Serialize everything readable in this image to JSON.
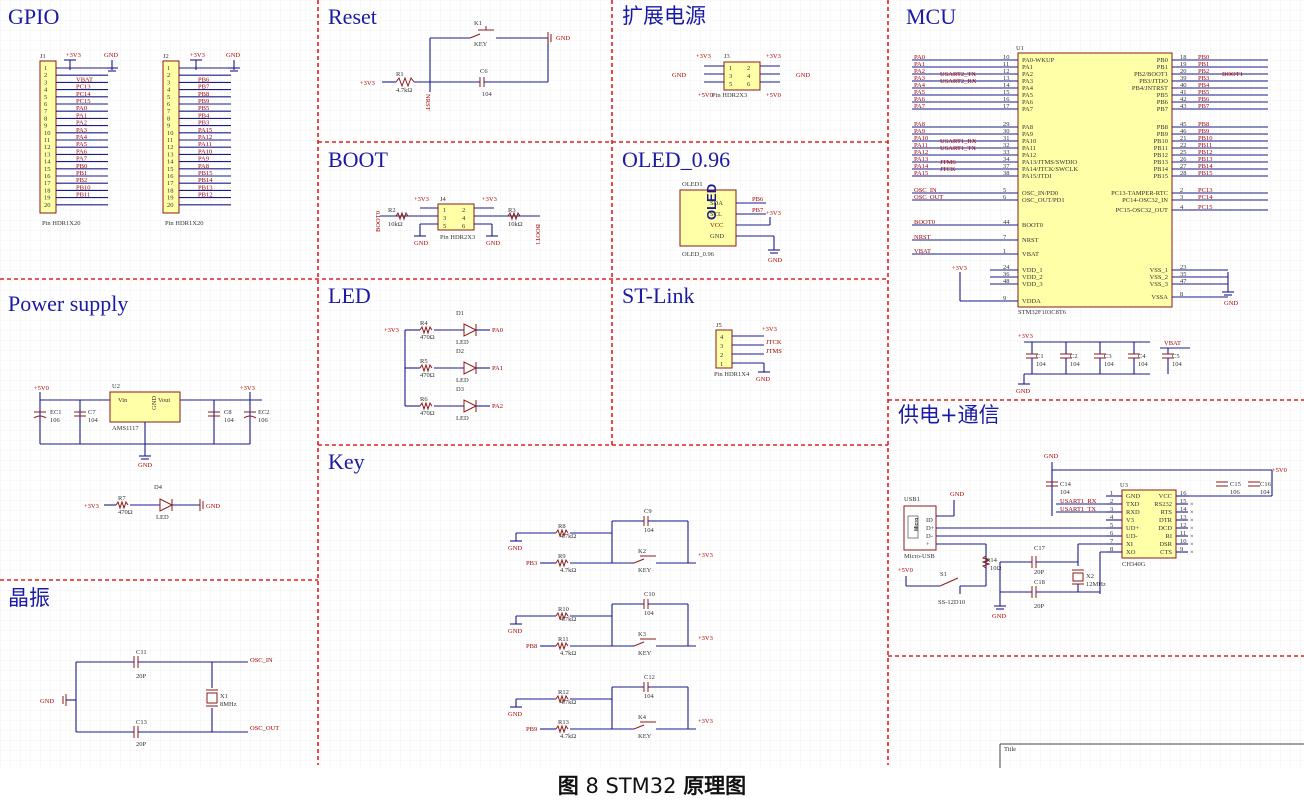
{
  "caption": {
    "prefix": "图",
    "number": " 8 STM32 ",
    "suffix": "原理图"
  },
  "sections": {
    "gpio": "GPIO",
    "reset": "Reset",
    "expand_power": "扩展电源",
    "mcu": "MCU",
    "boot": "BOOT",
    "oled": "OLED_0.96",
    "power_supply": "Power supply",
    "led": "LED",
    "stlink": "ST-Link",
    "key": "Key",
    "crystal": "晶振",
    "power_comm": "供电+通信"
  },
  "gpio": {
    "j1": {
      "ref": "J1",
      "footprint": "Pin HDR1X20",
      "pins": [
        "+3V3",
        "GND",
        "VBAT",
        "PC13",
        "PC14",
        "PC15",
        "PA0",
        "PA1",
        "PA2",
        "PA3",
        "PA4",
        "PA5",
        "PA6",
        "PA7",
        "PB0",
        "PB1",
        "PB2",
        "PB10",
        "PB11",
        ""
      ]
    },
    "j2": {
      "ref": "J2",
      "footprint": "Pin HDR1X20",
      "pins": [
        "+3V3",
        "GND",
        "PB6",
        "PB7",
        "PB8",
        "PB9",
        "PB5",
        "PB4",
        "PB3",
        "PA15",
        "PA12",
        "PA11",
        "PA10",
        "PA9",
        "PA8",
        "PB15",
        "PB14",
        "PB13",
        "PB12",
        ""
      ]
    }
  },
  "reset": {
    "sw": "K1",
    "sw_val": "KEY",
    "gnd": "GND",
    "r": "R1",
    "r_val": "4.7kΩ",
    "vcc": "+3V3",
    "c": "C6",
    "c_val": "104",
    "net": "NRST"
  },
  "expand": {
    "ref": "J3",
    "footprint": "Pin HDR2X3",
    "nets": [
      "+3V3",
      "+3V3",
      "GND",
      "GND",
      "+5V0",
      "+5V0"
    ]
  },
  "boot": {
    "ref": "J4",
    "footprint": "Pin HDR2X3",
    "r2": "R2",
    "r3": "R3",
    "r_val": "10kΩ",
    "vcc": "+3V3",
    "gnd": "GND",
    "net0": "BOOT0",
    "net1": "BOOT1"
  },
  "oled": {
    "ref": "OLED1",
    "name": "OLED",
    "val": "OLED_0.96",
    "pins": [
      "SDA",
      "SCL",
      "VCC",
      "GND"
    ],
    "nets": [
      "PB6",
      "PB7",
      "+3V3",
      "GND"
    ]
  },
  "power": {
    "in": "+5V0",
    "out": "+3V3",
    "u": "U2",
    "u_val": "AMS1117",
    "vin": "Vin",
    "vout": "Vout",
    "gnd": "GND",
    "ec1": "EC1",
    "ec1_val": "106",
    "c7": "C7",
    "c7_val": "104",
    "c8": "C8",
    "c8_val": "104",
    "ec2": "EC2",
    "ec2_val": "106",
    "r7": "R7",
    "r7_val": "470Ω",
    "d4": "D4",
    "d_val": "LED",
    "vcc": "+3V3"
  },
  "led": {
    "vcc": "+3V3",
    "rows": [
      {
        "r": "R4",
        "rv": "470Ω",
        "d": "D1",
        "dv": "LED",
        "net": "PA0"
      },
      {
        "r": "R5",
        "rv": "470Ω",
        "d": "D2",
        "dv": "LED",
        "net": "PA1"
      },
      {
        "r": "R6",
        "rv": "470Ω",
        "d": "D3",
        "dv": "LED",
        "net": "PA2"
      }
    ]
  },
  "stlink": {
    "ref": "J5",
    "footprint": "Pin HDR1X4",
    "nets": [
      "+3V3",
      "JTCK",
      "JTMS",
      "GND"
    ]
  },
  "keys": [
    {
      "r1": "R8",
      "c": "C9",
      "r2": "R9",
      "k": "K2",
      "net": "PB3",
      "rv": "4.7kΩ",
      "cv": "104",
      "kv": "KEY",
      "vcc": "+3V3",
      "gnd": "GND"
    },
    {
      "r1": "R10",
      "c": "C10",
      "r2": "R11",
      "k": "K3",
      "net": "PB8",
      "rv": "4.7kΩ",
      "cv": "104",
      "kv": "KEY",
      "vcc": "+3V3",
      "gnd": "GND"
    },
    {
      "r1": "R12",
      "c": "C12",
      "r2": "R13",
      "k": "K4",
      "net": "PB9",
      "rv": "4.7kΩ",
      "cv": "104",
      "kv": "KEY",
      "vcc": "+3V3",
      "gnd": "GND"
    }
  ],
  "crystal": {
    "c11": "C11",
    "c13": "C13",
    "c_val": "20P",
    "x": "X1",
    "x_val": "8MHz",
    "gnd": "GND",
    "net_in": "OSC_IN",
    "net_out": "OSC_OUT"
  },
  "mcu": {
    "ref": "U1",
    "part": "STM32F103C8T6",
    "left_pins": [
      {
        "pin": "10",
        "name": "PA0-WKUP",
        "net": "PA0"
      },
      {
        "pin": "11",
        "name": "PA1",
        "net": "PA1"
      },
      {
        "pin": "12",
        "name": "PA2",
        "net": "PA2",
        "net2": "USART2_TX"
      },
      {
        "pin": "13",
        "name": "PA3",
        "net": "PA3",
        "net2": "USART2_RX"
      },
      {
        "pin": "14",
        "name": "PA4",
        "net": "PA4"
      },
      {
        "pin": "15",
        "name": "PA5",
        "net": "PA5"
      },
      {
        "pin": "16",
        "name": "PA6",
        "net": "PA6"
      },
      {
        "pin": "17",
        "name": "PA7",
        "net": "PA7"
      },
      {
        "pin": "29",
        "name": "PA8",
        "net": "PA8"
      },
      {
        "pin": "30",
        "name": "PA9",
        "net": "PA9"
      },
      {
        "pin": "31",
        "name": "PA10",
        "net": "PA10",
        "net2": "USART1_RX"
      },
      {
        "pin": "32",
        "name": "PA11",
        "net": "PA11",
        "net2": "USART1_TX"
      },
      {
        "pin": "33",
        "name": "PA12",
        "net": "PA12"
      },
      {
        "pin": "34",
        "name": "PA13/JTMS/SWDIO",
        "net": "PA13",
        "net2": "JTMS"
      },
      {
        "pin": "37",
        "name": "PA14/JTCK/SWCLK",
        "net": "PA14",
        "net2": "JTCK"
      },
      {
        "pin": "38",
        "name": "PA15/JTDI",
        "net": "PA15"
      },
      {
        "pin": "5",
        "name": "OSC_IN/PD0",
        "net": "OSC_IN"
      },
      {
        "pin": "6",
        "name": "OSC_OUT/PD1",
        "net": "OSC_OUT"
      },
      {
        "pin": "44",
        "name": "BOOT0",
        "net": "BOOT0"
      },
      {
        "pin": "7",
        "name": "NRST",
        "net": "NRST"
      },
      {
        "pin": "1",
        "name": "VBAT",
        "net": "VBAT"
      },
      {
        "pin": "24",
        "name": "VDD_1",
        "net": ""
      },
      {
        "pin": "36",
        "name": "VDD_2",
        "net": ""
      },
      {
        "pin": "48",
        "name": "VDD_3",
        "net": ""
      },
      {
        "pin": "9",
        "name": "VDDA",
        "net": ""
      }
    ],
    "right_pins": [
      {
        "pin": "18",
        "name": "PB0",
        "net": "PB0"
      },
      {
        "pin": "19",
        "name": "PB1",
        "net": "PB1"
      },
      {
        "pin": "20",
        "name": "PB2/BOOT1",
        "net": "PB2",
        "net2": "BOOT1"
      },
      {
        "pin": "39",
        "name": "PB3/JTDO",
        "net": "PB3"
      },
      {
        "pin": "40",
        "name": "PB4/JNTRST",
        "net": "PB4"
      },
      {
        "pin": "41",
        "name": "PB5",
        "net": "PB5"
      },
      {
        "pin": "42",
        "name": "PB6",
        "net": "PB6"
      },
      {
        "pin": "43",
        "name": "PB7",
        "net": "PB7"
      },
      {
        "pin": "45",
        "name": "PB8",
        "net": "PB8"
      },
      {
        "pin": "46",
        "name": "PB9",
        "net": "PB9"
      },
      {
        "pin": "21",
        "name": "PB10",
        "net": "PB10"
      },
      {
        "pin": "22",
        "name": "PB11",
        "net": "PB11"
      },
      {
        "pin": "25",
        "name": "PB12",
        "net": "PB12"
      },
      {
        "pin": "26",
        "name": "PB13",
        "net": "PB13"
      },
      {
        "pin": "27",
        "name": "PB14",
        "net": "PB14"
      },
      {
        "pin": "28",
        "name": "PB15",
        "net": "PB15"
      },
      {
        "pin": "2",
        "name": "PC13-TAMPER-RTC",
        "net": "PC13"
      },
      {
        "pin": "3",
        "name": "PC14-OSC32_IN",
        "net": "PC14"
      },
      {
        "pin": "4",
        "name": "PC15-OSC32_OUT",
        "net": "PC15"
      },
      {
        "pin": "23",
        "name": "VSS_1",
        "net": ""
      },
      {
        "pin": "35",
        "name": "VSS_2",
        "net": ""
      },
      {
        "pin": "47",
        "name": "VSS_3",
        "net": ""
      },
      {
        "pin": "8",
        "name": "VSSA",
        "net": ""
      }
    ],
    "vcc": "+3V3",
    "gnd": "GND",
    "decoupling": [
      {
        "ref": "C1",
        "val": "104"
      },
      {
        "ref": "C2",
        "val": "104"
      },
      {
        "ref": "C3",
        "val": "104"
      },
      {
        "ref": "C4",
        "val": "104"
      },
      {
        "ref": "C5",
        "val": "104"
      }
    ],
    "vbat": "VBAT"
  },
  "comm": {
    "u": "U3",
    "part": "CH340G",
    "gnd": "GND",
    "vcc5": "+5V0",
    "c14": "C14",
    "c14_val": "104",
    "c15": "C15",
    "c15_val": "106",
    "c16": "C16",
    "c16_val": "104",
    "left": [
      {
        "name": "GND",
        "pin": "1"
      },
      {
        "name": "TXD",
        "pin": "2",
        "net": "USART1_RX"
      },
      {
        "name": "RXD",
        "pin": "3",
        "net": "USART1_TX"
      },
      {
        "name": "V3",
        "pin": "4"
      },
      {
        "name": "UD+",
        "pin": "5"
      },
      {
        "name": "UD-",
        "pin": "6"
      },
      {
        "name": "XI",
        "pin": "7"
      },
      {
        "name": "XO",
        "pin": "8"
      }
    ],
    "right": [
      {
        "name": "VCC",
        "pin": "16"
      },
      {
        "name": "RS232",
        "pin": "15"
      },
      {
        "name": "RTS",
        "pin": "14"
      },
      {
        "name": "DTR",
        "pin": "13"
      },
      {
        "name": "DCD",
        "pin": "12"
      },
      {
        "name": "RI",
        "pin": "11"
      },
      {
        "name": "DSR",
        "pin": "10"
      },
      {
        "name": "CTS",
        "pin": "9"
      }
    ],
    "usb": "USB1",
    "usb_val": "Micro-USB",
    "usb_pins": [
      "ID",
      "D+",
      "D-",
      "+"
    ],
    "usb_logo": "Micro",
    "r14": "R14",
    "r14_val": "10Ω",
    "c17": "C17",
    "c18": "C18",
    "c_val": "20P",
    "x2": "X2",
    "x2_val": "12MHz",
    "s1": "S1",
    "s1_val": "SS-12D10"
  },
  "title_block": {
    "label": "Title"
  }
}
